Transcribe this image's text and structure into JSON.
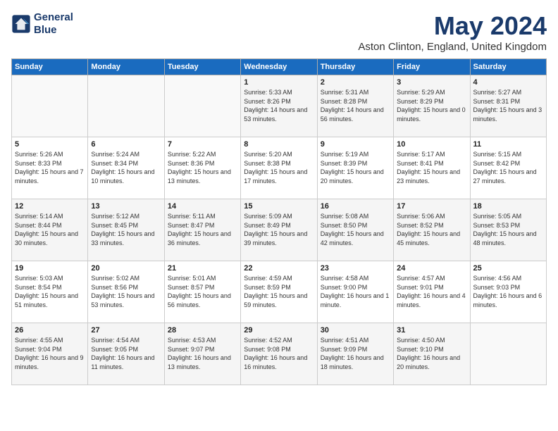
{
  "header": {
    "logo_line1": "General",
    "logo_line2": "Blue",
    "month_year": "May 2024",
    "location": "Aston Clinton, England, United Kingdom"
  },
  "days_of_week": [
    "Sunday",
    "Monday",
    "Tuesday",
    "Wednesday",
    "Thursday",
    "Friday",
    "Saturday"
  ],
  "weeks": [
    [
      {
        "day": "",
        "info": ""
      },
      {
        "day": "",
        "info": ""
      },
      {
        "day": "",
        "info": ""
      },
      {
        "day": "1",
        "info": "Sunrise: 5:33 AM\nSunset: 8:26 PM\nDaylight: 14 hours and 53 minutes."
      },
      {
        "day": "2",
        "info": "Sunrise: 5:31 AM\nSunset: 8:28 PM\nDaylight: 14 hours and 56 minutes."
      },
      {
        "day": "3",
        "info": "Sunrise: 5:29 AM\nSunset: 8:29 PM\nDaylight: 15 hours and 0 minutes."
      },
      {
        "day": "4",
        "info": "Sunrise: 5:27 AM\nSunset: 8:31 PM\nDaylight: 15 hours and 3 minutes."
      }
    ],
    [
      {
        "day": "5",
        "info": "Sunrise: 5:26 AM\nSunset: 8:33 PM\nDaylight: 15 hours and 7 minutes."
      },
      {
        "day": "6",
        "info": "Sunrise: 5:24 AM\nSunset: 8:34 PM\nDaylight: 15 hours and 10 minutes."
      },
      {
        "day": "7",
        "info": "Sunrise: 5:22 AM\nSunset: 8:36 PM\nDaylight: 15 hours and 13 minutes."
      },
      {
        "day": "8",
        "info": "Sunrise: 5:20 AM\nSunset: 8:38 PM\nDaylight: 15 hours and 17 minutes."
      },
      {
        "day": "9",
        "info": "Sunrise: 5:19 AM\nSunset: 8:39 PM\nDaylight: 15 hours and 20 minutes."
      },
      {
        "day": "10",
        "info": "Sunrise: 5:17 AM\nSunset: 8:41 PM\nDaylight: 15 hours and 23 minutes."
      },
      {
        "day": "11",
        "info": "Sunrise: 5:15 AM\nSunset: 8:42 PM\nDaylight: 15 hours and 27 minutes."
      }
    ],
    [
      {
        "day": "12",
        "info": "Sunrise: 5:14 AM\nSunset: 8:44 PM\nDaylight: 15 hours and 30 minutes."
      },
      {
        "day": "13",
        "info": "Sunrise: 5:12 AM\nSunset: 8:45 PM\nDaylight: 15 hours and 33 minutes."
      },
      {
        "day": "14",
        "info": "Sunrise: 5:11 AM\nSunset: 8:47 PM\nDaylight: 15 hours and 36 minutes."
      },
      {
        "day": "15",
        "info": "Sunrise: 5:09 AM\nSunset: 8:49 PM\nDaylight: 15 hours and 39 minutes."
      },
      {
        "day": "16",
        "info": "Sunrise: 5:08 AM\nSunset: 8:50 PM\nDaylight: 15 hours and 42 minutes."
      },
      {
        "day": "17",
        "info": "Sunrise: 5:06 AM\nSunset: 8:52 PM\nDaylight: 15 hours and 45 minutes."
      },
      {
        "day": "18",
        "info": "Sunrise: 5:05 AM\nSunset: 8:53 PM\nDaylight: 15 hours and 48 minutes."
      }
    ],
    [
      {
        "day": "19",
        "info": "Sunrise: 5:03 AM\nSunset: 8:54 PM\nDaylight: 15 hours and 51 minutes."
      },
      {
        "day": "20",
        "info": "Sunrise: 5:02 AM\nSunset: 8:56 PM\nDaylight: 15 hours and 53 minutes."
      },
      {
        "day": "21",
        "info": "Sunrise: 5:01 AM\nSunset: 8:57 PM\nDaylight: 15 hours and 56 minutes."
      },
      {
        "day": "22",
        "info": "Sunrise: 4:59 AM\nSunset: 8:59 PM\nDaylight: 15 hours and 59 minutes."
      },
      {
        "day": "23",
        "info": "Sunrise: 4:58 AM\nSunset: 9:00 PM\nDaylight: 16 hours and 1 minute."
      },
      {
        "day": "24",
        "info": "Sunrise: 4:57 AM\nSunset: 9:01 PM\nDaylight: 16 hours and 4 minutes."
      },
      {
        "day": "25",
        "info": "Sunrise: 4:56 AM\nSunset: 9:03 PM\nDaylight: 16 hours and 6 minutes."
      }
    ],
    [
      {
        "day": "26",
        "info": "Sunrise: 4:55 AM\nSunset: 9:04 PM\nDaylight: 16 hours and 9 minutes."
      },
      {
        "day": "27",
        "info": "Sunrise: 4:54 AM\nSunset: 9:05 PM\nDaylight: 16 hours and 11 minutes."
      },
      {
        "day": "28",
        "info": "Sunrise: 4:53 AM\nSunset: 9:07 PM\nDaylight: 16 hours and 13 minutes."
      },
      {
        "day": "29",
        "info": "Sunrise: 4:52 AM\nSunset: 9:08 PM\nDaylight: 16 hours and 16 minutes."
      },
      {
        "day": "30",
        "info": "Sunrise: 4:51 AM\nSunset: 9:09 PM\nDaylight: 16 hours and 18 minutes."
      },
      {
        "day": "31",
        "info": "Sunrise: 4:50 AM\nSunset: 9:10 PM\nDaylight: 16 hours and 20 minutes."
      },
      {
        "day": "",
        "info": ""
      }
    ]
  ]
}
